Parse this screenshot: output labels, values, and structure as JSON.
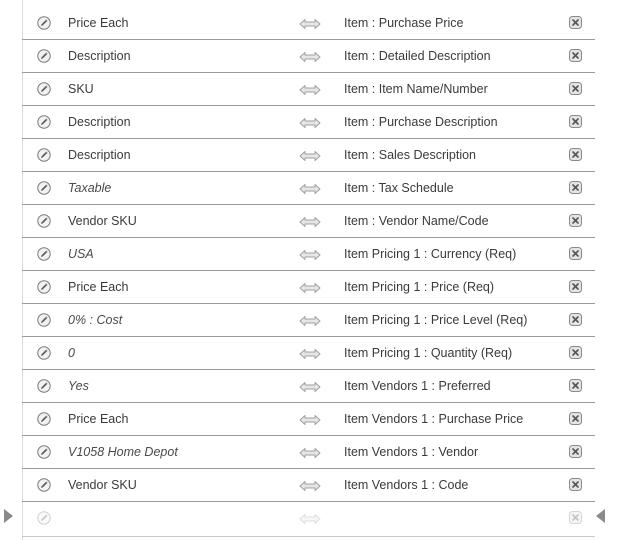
{
  "mappings": [
    {
      "source": "Price Each",
      "source_italic": false,
      "target": "Item : Purchase Price"
    },
    {
      "source": "Description",
      "source_italic": false,
      "target": "Item : Detailed Description"
    },
    {
      "source": "SKU",
      "source_italic": false,
      "target": "Item : Item Name/Number"
    },
    {
      "source": "Description",
      "source_italic": false,
      "target": "Item : Purchase Description"
    },
    {
      "source": "Description",
      "source_italic": false,
      "target": "Item : Sales Description"
    },
    {
      "source": "Taxable",
      "source_italic": true,
      "target": "Item : Tax Schedule"
    },
    {
      "source": "Vendor SKU",
      "source_italic": false,
      "target": "Item : Vendor Name/Code"
    },
    {
      "source": "USA",
      "source_italic": true,
      "target": "Item Pricing 1 : Currency (Req)"
    },
    {
      "source": "Price Each",
      "source_italic": false,
      "target": "Item Pricing 1 : Price (Req)"
    },
    {
      "source": "0% : Cost",
      "source_italic": true,
      "target": "Item Pricing 1 : Price Level (Req)"
    },
    {
      "source": "0",
      "source_italic": true,
      "target": "Item Pricing 1 : Quantity (Req)"
    },
    {
      "source": "Yes",
      "source_italic": true,
      "target": "Item Vendors 1 : Preferred"
    },
    {
      "source": "Price Each",
      "source_italic": false,
      "target": "Item Vendors 1 : Purchase Price"
    },
    {
      "source": "V1058 Home Depot",
      "source_italic": true,
      "target": "Item Vendors 1 : Vendor"
    },
    {
      "source": "Vendor SKU",
      "source_italic": false,
      "target": "Item Vendors 1 : Code"
    },
    {
      "source": "",
      "source_italic": false,
      "target": "",
      "empty": true
    }
  ],
  "icons": {
    "edit": "pencil-icon",
    "map": "double-arrow-icon",
    "delete": "close-icon",
    "row_marker": "triangle-marker-icon"
  },
  "colors": {
    "text": "#3a3a3a",
    "divider": "#9a9a9a",
    "icon": "#8a8a8a"
  }
}
